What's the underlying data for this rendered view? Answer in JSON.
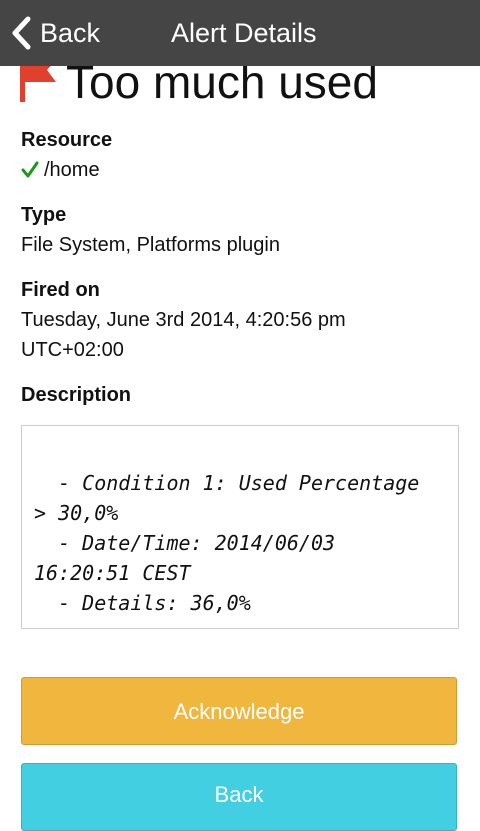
{
  "topbar": {
    "back_label": "Back",
    "title": "Alert Details"
  },
  "alert": {
    "title": "Too much used",
    "flag_color": "#e0412f"
  },
  "resource": {
    "label": "Resource",
    "value": "/home",
    "status_icon": "checkmark-icon",
    "status_color": "#1a9a1a"
  },
  "type": {
    "label": "Type",
    "value": "File System, Platforms plugin"
  },
  "fired_on": {
    "label": "Fired on",
    "value_line1": "Tuesday, June 3rd 2014, 4:20:56 pm",
    "value_line2": "UTC+02:00"
  },
  "description": {
    "label": "Description",
    "text": "  - Condition 1: Used Percentage\n> 30,0%\n  - Date/Time: 2014/06/03\n16:20:51 CEST\n  - Details: 36,0%"
  },
  "buttons": {
    "acknowledge_label": "Acknowledge",
    "back_label": "Back"
  },
  "colors": {
    "topbar": "#454545",
    "acknowledge": "#f0b63e",
    "back": "#43cfe2"
  }
}
